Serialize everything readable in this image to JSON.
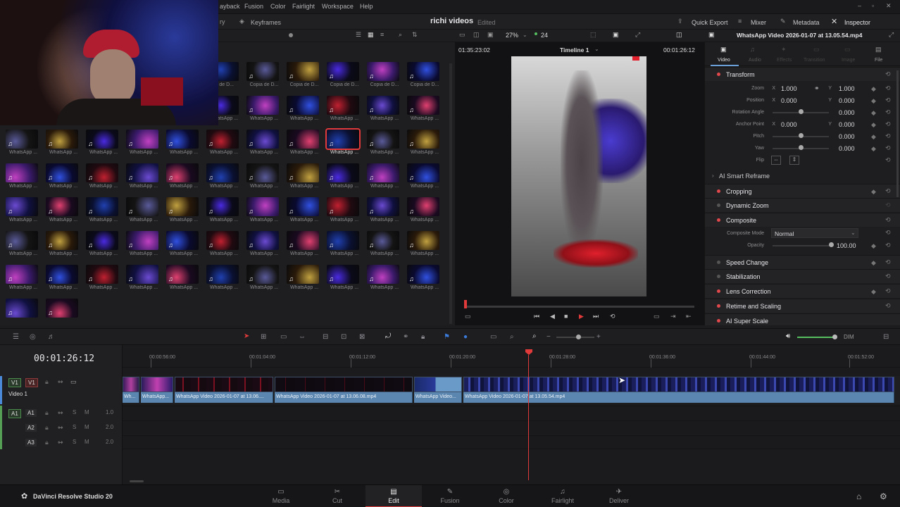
{
  "menu": [
    "ayback",
    "Fusion",
    "Color",
    "Fairlight",
    "Workspace",
    "Help"
  ],
  "toolbar": {
    "keyframes": "Keyframes",
    "project_title": "richi videos",
    "project_status": "Edited",
    "quick_export": "Quick Export",
    "mixer": "Mixer",
    "metadata": "Metadata",
    "inspector": "Inspector",
    "zoom": "27%",
    "fps": "24",
    "clip_name": "WhatsApp Video 2026-01-07 at 13.05.54.mp4"
  },
  "viewer": {
    "source_tc": "01:35:23:02",
    "timeline_name": "Timeline 1",
    "record_tc": "00:01:26:12"
  },
  "mediapool": {
    "clip_label_short": "WhatsApp ...",
    "copy_label": "Copia de D...",
    "partial_label": "ia de D..."
  },
  "inspector": {
    "tabs": [
      "Video",
      "Audio",
      "Effects",
      "Transition",
      "Image",
      "File"
    ],
    "transform": "Transform",
    "zoom_label": "Zoom",
    "zoom_x": "1.000",
    "zoom_y": "1.000",
    "position_label": "Position",
    "pos_x": "0.000",
    "pos_y": "0.000",
    "rotation_label": "Rotation Angle",
    "rotation": "0.000",
    "anchor_label": "Anchor Point",
    "anchor_x": "0.000",
    "anchor_y": "0.000",
    "pitch_label": "Pitch",
    "pitch": "0.000",
    "yaw_label": "Yaw",
    "yaw": "0.000",
    "flip_label": "Flip",
    "x": "X",
    "y": "Y",
    "smart_reframe": "AI Smart Reframe",
    "cropping": "Cropping",
    "dynamic_zoom": "Dynamic Zoom",
    "composite": "Composite",
    "composite_mode_label": "Composite Mode",
    "composite_mode": "Normal",
    "opacity_label": "Opacity",
    "opacity": "100.00",
    "speed_change": "Speed Change",
    "stabilization": "Stabilization",
    "lens_correction": "Lens Correction",
    "retime": "Retime and Scaling",
    "super_scale": "AI Super Scale"
  },
  "timeline": {
    "timecode": "00:01:26:12",
    "ruler": [
      "00:00:56:00",
      "00:01:04:00",
      "00:01:12:00",
      "00:01:20:00",
      "00:01:28:00",
      "00:01:36:00",
      "00:01:44:00",
      "00:01:52:00"
    ],
    "tracks": {
      "v1_btn": "V1",
      "v1": "V1",
      "video1": "Video 1",
      "a1_btn": "A1",
      "a1": "A1",
      "a2": "A2",
      "a3": "A3",
      "a1_level": "1.0",
      "a2_level": "2.0",
      "a3_level": "2.0",
      "s": "S",
      "m": "M"
    },
    "clips": [
      "Wh...",
      "WhatsApp...",
      "WhatsApp Video 2026-01-07 at 13.06....",
      "WhatsApp Video 2026-01-07 at 13.06.08.mp4",
      "WhatsApp Video...",
      "WhatsApp Video 2026-01-07 at 13.05.54.mp4"
    ],
    "dim": "DIM"
  },
  "app_name": "DaVinci Resolve Studio 20",
  "pages": [
    "Media",
    "Cut",
    "Edit",
    "Fusion",
    "Color",
    "Fairlight",
    "Deliver"
  ],
  "active_page": "Edit",
  "colors": {
    "accent_red": "#e0484c",
    "clip_blue": "#5b86b0",
    "playhead": "#e03a3a"
  }
}
